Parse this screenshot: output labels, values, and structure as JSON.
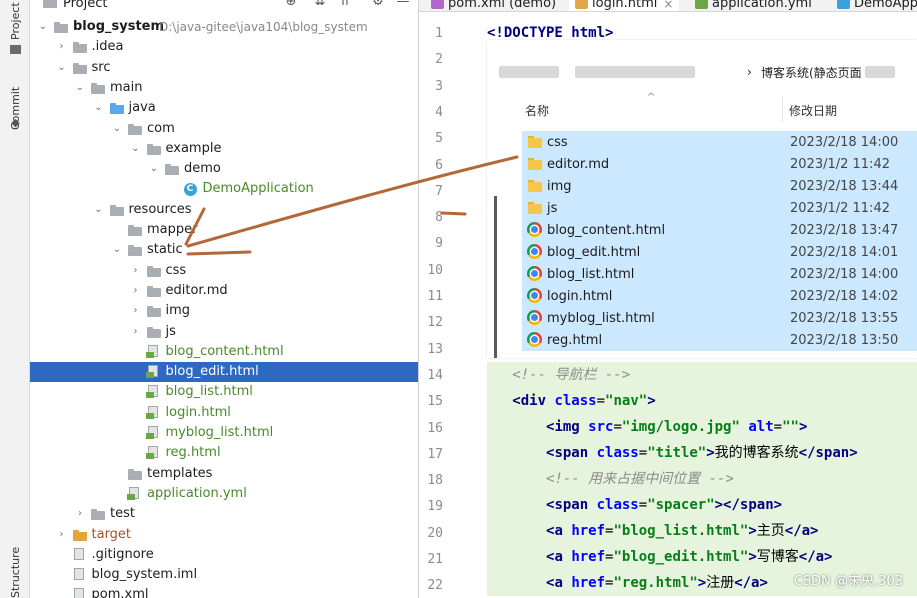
{
  "toolstrip": {
    "project_label": "Project",
    "commit_label": "Commit",
    "structure_label": "Structure"
  },
  "project": {
    "header": "Project",
    "rows": [
      {
        "label": "blog_system",
        "extra": "D:\\java-gitee\\java104\\blog_system",
        "type": "module",
        "depth": 0,
        "chevron": "down"
      },
      {
        "label": ".idea",
        "type": "folder",
        "depth": 1,
        "chevron": "right"
      },
      {
        "label": "src",
        "type": "folder",
        "depth": 1,
        "chevron": "down"
      },
      {
        "label": "main",
        "type": "folder",
        "depth": 2,
        "chevron": "down"
      },
      {
        "label": "java",
        "type": "folder-blue",
        "depth": 3,
        "chevron": "down"
      },
      {
        "label": "com",
        "type": "folder",
        "depth": 4,
        "chevron": "down"
      },
      {
        "label": "example",
        "type": "folder",
        "depth": 5,
        "chevron": "down"
      },
      {
        "label": "demo",
        "type": "folder",
        "depth": 6,
        "chevron": "down"
      },
      {
        "label": "DemoApplication",
        "type": "class",
        "depth": 7,
        "chevron": ""
      },
      {
        "label": "resources",
        "type": "folder-res",
        "depth": 3,
        "chevron": "down"
      },
      {
        "label": "mapper",
        "type": "folder",
        "depth": 4,
        "chevron": ""
      },
      {
        "label": "static",
        "type": "folder",
        "depth": 4,
        "chevron": "down"
      },
      {
        "label": "css",
        "type": "folder",
        "depth": 5,
        "chevron": "right"
      },
      {
        "label": "editor.md",
        "type": "folder",
        "depth": 5,
        "chevron": "right"
      },
      {
        "label": "img",
        "type": "folder",
        "depth": 5,
        "chevron": "right"
      },
      {
        "label": "js",
        "type": "folder",
        "depth": 5,
        "chevron": "right"
      },
      {
        "label": "blog_content.html",
        "type": "html",
        "depth": 5,
        "chevron": ""
      },
      {
        "label": "blog_edit.html",
        "type": "html",
        "depth": 5,
        "chevron": "",
        "selected": true
      },
      {
        "label": "blog_list.html",
        "type": "html",
        "depth": 5,
        "chevron": ""
      },
      {
        "label": "login.html",
        "type": "html",
        "depth": 5,
        "chevron": ""
      },
      {
        "label": "myblog_list.html",
        "type": "html",
        "depth": 5,
        "chevron": ""
      },
      {
        "label": "reg.html",
        "type": "html",
        "depth": 5,
        "chevron": ""
      },
      {
        "label": "templates",
        "type": "folder",
        "depth": 4,
        "chevron": ""
      },
      {
        "label": "application.yml",
        "type": "yml",
        "depth": 4,
        "chevron": ""
      },
      {
        "label": "test",
        "type": "folder",
        "depth": 2,
        "chevron": "right"
      },
      {
        "label": "target",
        "type": "folder-orange",
        "depth": 1,
        "chevron": "right"
      },
      {
        "label": ".gitignore",
        "type": "file",
        "depth": 1,
        "chevron": ""
      },
      {
        "label": "blog_system.iml",
        "type": "file",
        "depth": 1,
        "chevron": ""
      },
      {
        "label": "pom.xml",
        "type": "file",
        "depth": 1,
        "chevron": ""
      }
    ]
  },
  "editor": {
    "tabs": [
      {
        "label": "pom.xml (demo)",
        "color": "#b069c8",
        "active": false
      },
      {
        "label": "login.html",
        "color": "#e0a84a",
        "active": true
      },
      {
        "label": "application.yml",
        "color": "#6aa843",
        "active": false
      },
      {
        "label": "DemoAppli",
        "color": "#3aa1d9",
        "active": false
      }
    ],
    "line_numbers": [
      "1",
      "2",
      "3",
      "4",
      "5",
      "6",
      "7",
      "8",
      "9",
      "10",
      "11",
      "12",
      "13",
      "14",
      "15",
      "16",
      "17",
      "18",
      "19",
      "20",
      "21",
      "22"
    ],
    "code": {
      "l1_a": "<!DOCTYPE ",
      "l1_b": "html",
      "l1_c": ">",
      "l14": "<!-- 导航栏 -->",
      "l15_a": "<div ",
      "l15_b": "class",
      "l15_c": "=",
      "l15_d": "\"nav\"",
      "l15_e": ">",
      "l16_a": "<img ",
      "l16_b": "src",
      "l16_c": "=",
      "l16_d": "\"img/logo.jpg\"",
      "l16_e": " alt",
      "l16_f": "=",
      "l16_g": "\"\"",
      "l16_h": ">",
      "l17_a": "<span ",
      "l17_b": "class",
      "l17_c": "=",
      "l17_d": "\"title\"",
      "l17_e": ">",
      "l17_f": "我的博客系统",
      "l17_g": "</span>",
      "l18": "<!-- 用来占据中间位置 -->",
      "l19_a": "<span ",
      "l19_b": "class",
      "l19_c": "=",
      "l19_d": "\"spacer\"",
      "l19_e": "></span>",
      "l20_a": "<a ",
      "l20_b": "href",
      "l20_c": "=",
      "l20_d": "\"blog_list.html\"",
      "l20_e": ">",
      "l20_f": "主页",
      "l20_g": "</a>",
      "l21_a": "<a ",
      "l21_b": "href",
      "l21_c": "=",
      "l21_d": "\"blog_edit.html\"",
      "l21_e": ">",
      "l21_f": "写博客",
      "l21_g": "</a>",
      "l22_a": "<a ",
      "l22_b": "href",
      "l22_c": "=",
      "l22_d": "\"reg.html\"",
      "l22_e": ">",
      "l22_f": "注册",
      "l22_g": "</a>"
    }
  },
  "explorer": {
    "breadcrumb_sep": "›",
    "breadcrumb_tail": "博客系统(静态页面",
    "col_name": "名称",
    "col_date": "修改日期",
    "files": [
      {
        "name": "css",
        "date": "2023/2/18 14:00",
        "kind": "folder"
      },
      {
        "name": "editor.md",
        "date": "2023/1/2 11:42",
        "kind": "folder"
      },
      {
        "name": "img",
        "date": "2023/2/18 13:44",
        "kind": "folder"
      },
      {
        "name": "js",
        "date": "2023/1/2 11:42",
        "kind": "folder"
      },
      {
        "name": "blog_content.html",
        "date": "2023/2/18 13:47",
        "kind": "chrome"
      },
      {
        "name": "blog_edit.html",
        "date": "2023/2/18 14:01",
        "kind": "chrome"
      },
      {
        "name": "blog_list.html",
        "date": "2023/2/18 14:00",
        "kind": "chrome"
      },
      {
        "name": "login.html",
        "date": "2023/2/18 14:02",
        "kind": "chrome"
      },
      {
        "name": "myblog_list.html",
        "date": "2023/2/18 13:55",
        "kind": "chrome"
      },
      {
        "name": "reg.html",
        "date": "2023/2/18 13:50",
        "kind": "chrome"
      }
    ]
  },
  "watermark": "CSDN @未央.303",
  "colors": {
    "selection": "#2e68c2",
    "explorer_highlight": "#cce8ff",
    "annotation": "#b4683a",
    "line_highlight": "#e6f4dd"
  }
}
